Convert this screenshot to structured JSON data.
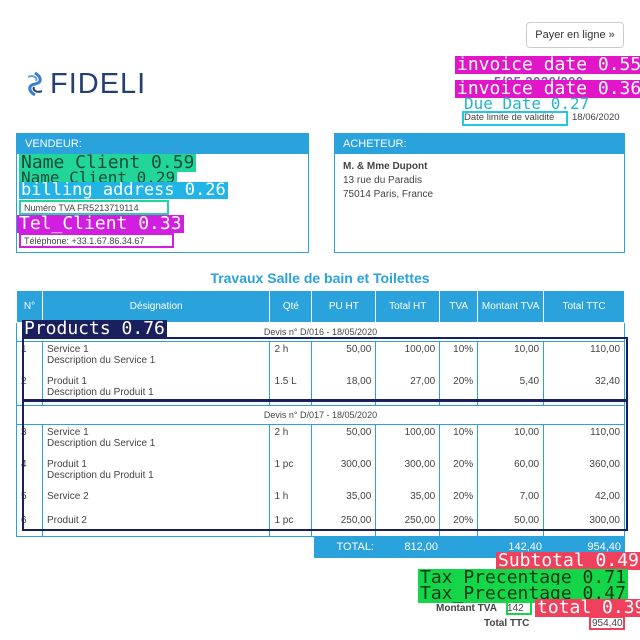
{
  "header": {
    "pay_button": "Payer en ligne »",
    "logo_text": "FIDELI",
    "due_label": "Date limite de validité",
    "due_value": "18/06/2020",
    "invoice_date_overlap": "5/05 2020/000"
  },
  "seller": {
    "title": "VENDEUR:",
    "vat": "Numéro TVA FR5213719114",
    "phone": "Téléphone: +33.1.67.86.34.67"
  },
  "buyer": {
    "title": "ACHETEUR:",
    "name": "M. & Mme Dupont",
    "address1": "13 rue du Paradis",
    "address2": "75014 Paris, France"
  },
  "table": {
    "title": "Travaux Salle de bain et Toilettes",
    "headers": [
      "N°",
      "Désignation",
      "Qté",
      "PU HT",
      "Total HT",
      "TVA",
      "Montant TVA",
      "Total TTC"
    ],
    "groups": [
      {
        "label": "Devis n° D/016 - 18/05/2020",
        "rows": [
          {
            "n": "1",
            "name": "Service 1",
            "desc": "Description du Service 1",
            "qty": "2 h",
            "pu": "50,00",
            "total_ht": "100,00",
            "tva": "10%",
            "montant_tva": "10,00",
            "total_ttc": "110,00"
          },
          {
            "n": "2",
            "name": "Produit 1",
            "desc": "Description du Produit 1",
            "qty": "1.5 L",
            "pu": "18,00",
            "total_ht": "27,00",
            "tva": "20%",
            "montant_tva": "5,40",
            "total_ttc": "32,40"
          }
        ]
      },
      {
        "label": "Devis n° D/017 - 18/05/2020",
        "rows": [
          {
            "n": "3",
            "name": "Service 1",
            "desc": "Description du Service 1",
            "qty": "2 h",
            "pu": "50,00",
            "total_ht": "100,00",
            "tva": "10%",
            "montant_tva": "10,00",
            "total_ttc": "110,00"
          },
          {
            "n": "4",
            "name": "Produit 1",
            "desc": "Description du Produit 1",
            "qty": "1 pc",
            "pu": "300,00",
            "total_ht": "300,00",
            "tva": "20%",
            "montant_tva": "60,00",
            "total_ttc": "360,00"
          },
          {
            "n": "5",
            "name": "Service 2",
            "desc": "",
            "qty": "1 h",
            "pu": "35,00",
            "total_ht": "35,00",
            "tva": "20%",
            "montant_tva": "7,00",
            "total_ttc": "42,00"
          },
          {
            "n": "6",
            "name": "Produit 2",
            "desc": "",
            "qty": "1 pc",
            "pu": "250,00",
            "total_ht": "250,00",
            "tva": "20%",
            "montant_tva": "50,00",
            "total_ttc": "300,00"
          }
        ]
      }
    ],
    "totals": {
      "label": "TOTAL:",
      "ht": "812,00",
      "tva": "142,40",
      "ttc": "954,40"
    }
  },
  "summary": {
    "montant_tva_label": "Montant TVA",
    "montant_tva_value": "142",
    "total_ttc_label": "Total TTC",
    "total_ttc_value": "954,40"
  },
  "annotations": [
    {
      "text": "invoice date 0.55",
      "color": "#e016c8"
    },
    {
      "text": "invoice date 0.36",
      "color": "#e016c8"
    },
    {
      "text": "Due_Date 0.27",
      "color": "#22c8e0"
    },
    {
      "text": "Name_Client 0.59",
      "color": "#22d69a"
    },
    {
      "text": "Name_Client 0.29",
      "color": "#22d69a"
    },
    {
      "text": "billing address 0.26",
      "color": "#22b4e6"
    },
    {
      "text": "Tel_Client 0.33",
      "color": "#d21ee0"
    },
    {
      "text": "Products 0.76",
      "color": "#1a1f5e"
    },
    {
      "text": "Subtotal 0.49",
      "color": "#f0405c"
    },
    {
      "text": "Tax_Precentage 0.71",
      "color": "#14d648"
    },
    {
      "text": "Tax_Precentage 0.47",
      "color": "#14d648"
    },
    {
      "text": "total 0.39",
      "color": "#f0405c"
    }
  ]
}
